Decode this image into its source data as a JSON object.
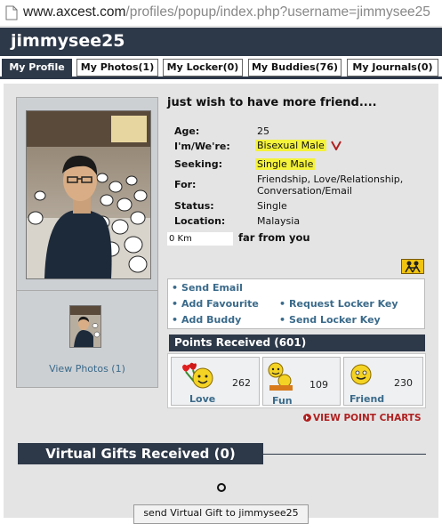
{
  "browser": {
    "url_host": "www.axcest.com",
    "url_rest": "/profiles/popup/index.php?username=jimmysee25"
  },
  "header": {
    "username": "jimmysee25"
  },
  "tabs": [
    {
      "label": "My Profile"
    },
    {
      "label": "My Photos(1)"
    },
    {
      "label": "My Locker(0)"
    },
    {
      "label": "My Buddies(76)"
    },
    {
      "label": "My Journals(0)"
    }
  ],
  "profile": {
    "status_message": "just wish to have more friend....",
    "fields": {
      "age": {
        "label": "Age:",
        "value": "25"
      },
      "im": {
        "label": "I'm/We're:",
        "value": "Bisexual Male"
      },
      "seeking": {
        "label": "Seeking:",
        "value": "Single Male"
      },
      "for": {
        "label": "For:",
        "value_line1": "Friendship, Love/Relationship,",
        "value_line2": "Conversation/Email"
      },
      "status": {
        "label": "Status:",
        "value": "Single"
      },
      "location": {
        "label": "Location:",
        "value": "Malaysia"
      }
    },
    "distance": {
      "value": "0 Km",
      "label": "far from you"
    },
    "view_photos": "View Photos (1)"
  },
  "actions": {
    "send_email": "Send Email",
    "add_favourite": "Add Favourite",
    "add_buddy": "Add Buddy",
    "request_locker_key": "Request Locker Key",
    "send_locker_key": "Send Locker Key"
  },
  "points": {
    "header": "Points Received (601)",
    "items": [
      {
        "name": "Love",
        "count": "262"
      },
      {
        "name": "Fun",
        "count": "109"
      },
      {
        "name": "Friend",
        "count": "230"
      }
    ],
    "view_charts": "VIEW POINT CHARTS"
  },
  "gifts": {
    "header": "Virtual Gifts Received (0)",
    "send_button": "send Virtual Gift to jimmysee25"
  },
  "colors": {
    "navy": "#2d3848",
    "highlight": "#f4f23a",
    "link": "#3a6a8a",
    "red_link": "#b02020"
  }
}
